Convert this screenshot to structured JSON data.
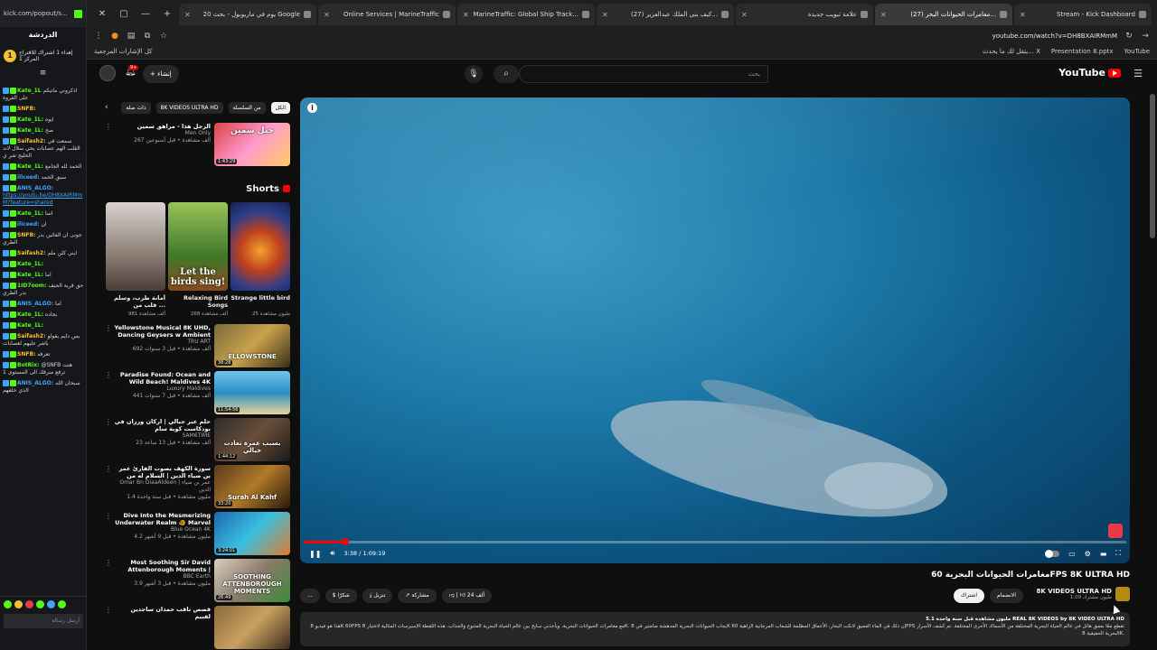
{
  "chat": {
    "url": "kick.com/popout/s...",
    "heading": "الدردشة",
    "goal": "إهداء 1 اشتراك للاقتراح المركز 1",
    "goal_icon": "1",
    "input_placeholder": "أرسل رسالة",
    "messages": [
      {
        "user": "Kate_1L",
        "text": "اذكروني ماتيكم على الفروة",
        "color": "#53fc18"
      },
      {
        "user": "SNFB:",
        "text": "",
        "color": "#f2c230"
      },
      {
        "user": "Kate_1L:",
        "text": "ايوه",
        "color": "#53fc18"
      },
      {
        "user": "Kate_1L:",
        "text": "صح",
        "color": "#53fc18"
      },
      {
        "user": "Saifash2:",
        "text": "سمعت في القلب الهم عصابات يحي سلال لاند الخليج شر ي",
        "color": "#f2c230"
      },
      {
        "user": "Kate_1L:",
        "text": "الحمد لله الجامع",
        "color": "#53fc18"
      },
      {
        "user": "iliceed:",
        "text": "سبق الحمد",
        "color": "#3ea6ff"
      },
      {
        "user": "ANIS_ALGO:",
        "text": "",
        "link": "https://youtu.be/DH8XAIRMmM?feature=shared",
        "color": "#3ea6ff"
      },
      {
        "user": "Kate_1L:",
        "text": "اسا",
        "color": "#53fc18"
      },
      {
        "user": "iliceed:",
        "text": "ان",
        "color": "#3ea6ff"
      },
      {
        "user": "SNFB:",
        "text": "جونى ان الفائين بدر الطري",
        "color": "#f2c230"
      },
      {
        "user": "Saifash2:",
        "text": "ايني كلن ملم",
        "color": "#f2c230"
      },
      {
        "user": "Kate_1L:",
        "text": "",
        "color": "#53fc18"
      },
      {
        "user": "Kate_1L:",
        "text": "اما",
        "color": "#53fc18"
      },
      {
        "user": "1ID7oom:",
        "text": "حق قرية الحيف بدر الطري",
        "color": "#53fc18"
      },
      {
        "user": "ANIS_ALGO:",
        "text": "اما",
        "color": "#3ea6ff"
      },
      {
        "user": "Kate_1L:",
        "text": "يجاده",
        "color": "#53fc18"
      },
      {
        "user": "Kate_1L:",
        "text": "",
        "color": "#53fc18"
      },
      {
        "user": "Saifash2:",
        "text": "يس دايم يقولو باشر عليهم لعصابات",
        "color": "#f2c230"
      },
      {
        "user": "SNFB:",
        "text": "تعرفه",
        "color": "#f2c230"
      },
      {
        "user": "BotRix:",
        "text": "@SNFB هنت ترفع منرقك الى المستوى 1",
        "color": "#53fc18"
      },
      {
        "user": "ANIS_ALGO:",
        "text": "سبحان الله الذي خلقهم",
        "color": "#3ea6ff"
      }
    ]
  },
  "tabs": [
    {
      "label": "Stream - Kick Dashboard",
      "active": false
    },
    {
      "label": "(27) مغامرات الحيوانات البحر...",
      "active": true
    },
    {
      "label": "علامة تبويب جديدة",
      "active": false
    },
    {
      "label": "(27) كيف بنى الملك عبدالعزيز...",
      "active": false
    },
    {
      "label": "MarineTraffic: Global Ship Track...",
      "active": false
    },
    {
      "label": "Online Services | MarineTraffic",
      "active": false
    },
    {
      "label": "20 يوم في ماريوبول - بحث Google",
      "active": false
    }
  ],
  "address": {
    "url": "youtube.com/watch?v=DH8BXAIRMmM"
  },
  "bookmarks": {
    "left": "كل الإشارات المرجعية",
    "right": [
      "YouTube",
      "Presentation 8.pptx",
      "يتقل لك ما يحدث... X"
    ]
  },
  "header": {
    "logo": "YouTube",
    "search_placeholder": "بحث",
    "create_label": "إنشاء",
    "bell_count": "9+"
  },
  "chips": [
    "الكل",
    "من السلسلة",
    "8K VIDEOS ULTRA HD",
    "ذات صلة"
  ],
  "recs_top": {
    "title": "الرجل هذا - مراهق سمين",
    "channel": "Men Only",
    "views": "267 ألف مشاهدة • قبل أسبوعين",
    "duration": "1:43:29",
    "thumb_text": "جيل سمين"
  },
  "shorts": {
    "title": "Shorts",
    "items": [
      {
        "title": "Strange little bird",
        "views": "25 مليون مشاهدة"
      },
      {
        "title": "Relaxing Bird Songs",
        "views": "268 ألف مشاهدة",
        "thumb_text": "Let the birds sing!"
      },
      {
        "title": "أمانة طرب، وسلم قلب من ...",
        "views": "981 ألف مشاهدة"
      }
    ]
  },
  "recs": [
    {
      "title": "Yellowstone Musical 8K UHD, Dancing Geysers w Ambient ...",
      "channel": "TRU ART",
      "views": "692 ألف مشاهدة • قبل 3 سنوات",
      "duration": "38:28",
      "thumb_text": "ELLOWSTONE"
    },
    {
      "title": "Paradise Found: Ocean and Wild Beach! Maldives 4K ULTRA HD",
      "channel": "Luxury Maldives",
      "views": "441 ألف مشاهدة • قبل 7 سنوات",
      "duration": "11:54:56",
      "thumb_text": ""
    },
    {
      "title": "حلم عبر جبالي | اركان ورزان في بودكاست كوبة سام",
      "channel": "SAM6TIME",
      "views": "23 ألف مشاهدة • قبل 13 ساعة",
      "duration": "1:44:12",
      "thumb_text": "بسبب عمرة تعادت خيالي"
    },
    {
      "title": "سورة الكهف بصوت القارئ عمر بن ضياء الدين | السلام له من النور ما بين الجمعتين",
      "channel": "Omar Bn DiaaAldeen | عمر بن ضياء الدين",
      "views": "1.4 مليون مشاهدة • قبل سنة واحدة",
      "duration": "33:20",
      "thumb_text": "Surah Al Kahf"
    },
    {
      "title": "Dive Into the Mesmerizing Underwater Realm 🐠 Marvel at ...",
      "channel": "Blue Ocean 4K",
      "views": "4.2 مليون مشاهدة • قبل 9 أشهر",
      "duration": "3:24:01",
      "thumb_text": ""
    },
    {
      "title": "Most Soothing Sir David Attenborough Moments | BBC",
      "channel": "BBC Earth",
      "views": "3.9 مليون مشاهدة • قبل 3 أشهر",
      "duration": "26:49",
      "thumb_text": "SOOTHING ATTENBOROUGH MOMENTS"
    },
    {
      "title": "قصص ناقب حمدان ساجدين لقبيم",
      "channel": "",
      "views": "",
      "duration": "",
      "thumb_text": ""
    }
  ],
  "player": {
    "time": "3:38 / 1:09:19",
    "progress_fraction": 0.05
  },
  "video": {
    "title": "مغامرات الحيوانات البحرية 60FPS 8K ULTRA HD",
    "channel_name": "8K VIDEOS ULTRA HD",
    "subscribers": "1.09 مليون مشترك",
    "join_label": "الانضمام",
    "subscribe_label": "اشتراك",
    "likes": "24 ألف",
    "share_label": "مشاركة",
    "download_label": "تنزيل",
    "thanks_label": "شكرًا",
    "more_label": "...",
    "desc_head": "5.1 مليون مشاهدة  قبل سنة واحدة  REAL 8K VIDEOS by 8K VIDEO ULTRA HD",
    "desc_body": "هذا هو فيديو 8K 60FPS مع مغامرات الحيوانات البحرية، ويأخذني سابح بين عالم الحياة البحرية المتنوع والجذاب. هذه اللقطة الإسبرسات المثالية لاختيار 8K. يجاب الحيوانات البحرية المدهشة صامتير في 8K إن ذلك في الماء العميق لانكت البحار، الأعماق المظلمة للشعاب المرجانية الزاهية 60FPS تقطع معًا بعمق هائل في عالم الحياة البحرية المختلفة من الأسماك الأخرى المختلفة. تم كشف الأسرار البحرية الحقيقية 8K."
  },
  "colors": {
    "accent": "#ff0000",
    "kick_green": "#53fc18",
    "link_blue": "#3ea6ff"
  }
}
